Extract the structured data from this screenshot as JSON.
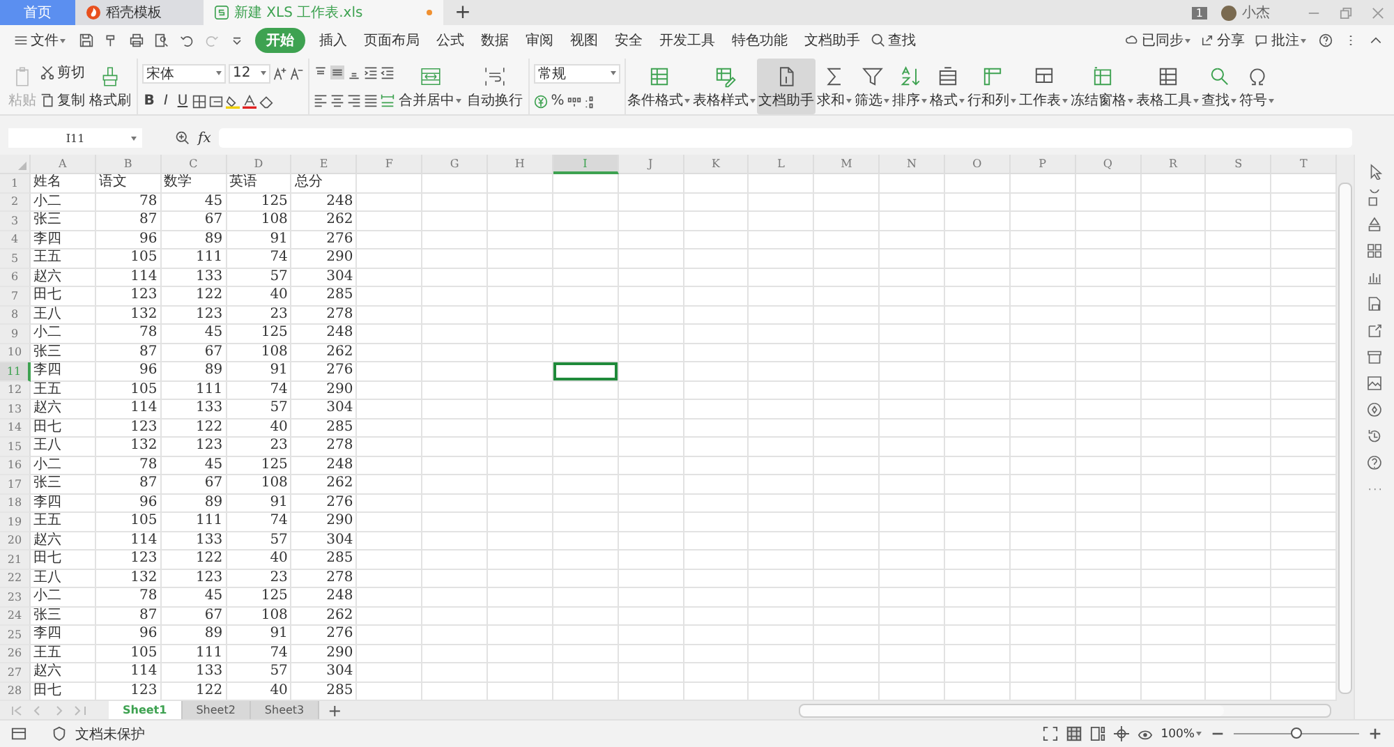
{
  "tabs": [
    {
      "label": "首页",
      "kind": "home",
      "selected": false,
      "unsaved": false
    },
    {
      "label": "稻壳模板",
      "kind": "docer",
      "selected": false,
      "unsaved": false
    },
    {
      "label": "新建 XLS 工作表.xls",
      "kind": "sheet",
      "selected": true,
      "unsaved": true
    }
  ],
  "new_tab": "+",
  "notification_count": "1",
  "user": {
    "name": "小杰"
  },
  "menu": {
    "file": "文件",
    "items": [
      {
        "label": "开始",
        "selected": true
      },
      {
        "label": "插入",
        "selected": false
      },
      {
        "label": "页面布局",
        "selected": false
      },
      {
        "label": "公式",
        "selected": false
      },
      {
        "label": "数据",
        "selected": false
      },
      {
        "label": "审阅",
        "selected": false
      },
      {
        "label": "视图",
        "selected": false
      },
      {
        "label": "安全",
        "selected": false
      },
      {
        "label": "开发工具",
        "selected": false
      },
      {
        "label": "特色功能",
        "selected": false
      },
      {
        "label": "文档助手",
        "selected": false
      }
    ],
    "search": "查找"
  },
  "actions": [
    {
      "label": "已同步",
      "kind": "cloud",
      "dropdown": true
    },
    {
      "label": "分享",
      "kind": "share",
      "dropdown": false
    },
    {
      "label": "批注",
      "kind": "comment",
      "dropdown": true
    }
  ],
  "ribbon": {
    "paste": {
      "label": "粘贴",
      "disabled": true
    },
    "cut": "剪切",
    "copy": "复制",
    "format_painter": "格式刷",
    "font": {
      "family": "宋体",
      "size": "12"
    },
    "font_styles": [
      "B",
      "I",
      "U"
    ],
    "merge": "合并居中",
    "wrap": "自动换行",
    "number_format": "常规",
    "percent": "%",
    "tools": [
      {
        "label": "条件格式",
        "kind": "grid",
        "dropdown": true,
        "pressed": false
      },
      {
        "label": "表格样式",
        "kind": "pen",
        "dropdown": true,
        "pressed": false
      },
      {
        "label": "文档助手",
        "kind": "doc",
        "dropdown": false,
        "pressed": true
      },
      {
        "label": "求和",
        "kind": "sum",
        "dropdown": true,
        "pressed": false
      },
      {
        "label": "筛选",
        "kind": "filter",
        "dropdown": true,
        "pressed": false
      },
      {
        "label": "排序",
        "kind": "sort",
        "dropdown": true,
        "pressed": false
      },
      {
        "label": "格式",
        "kind": "format",
        "dropdown": true,
        "pressed": false
      },
      {
        "label": "行和列",
        "kind": "rowcol",
        "dropdown": true,
        "pressed": false
      },
      {
        "label": "工作表",
        "kind": "sheet",
        "dropdown": true,
        "pressed": false
      },
      {
        "label": "冻结窗格",
        "kind": "freeze",
        "dropdown": true,
        "pressed": false
      },
      {
        "label": "表格工具",
        "kind": "table",
        "dropdown": true,
        "pressed": false
      },
      {
        "label": "查找",
        "kind": "find",
        "dropdown": true,
        "pressed": false
      },
      {
        "label": "符号",
        "kind": "symbol",
        "dropdown": true,
        "pressed": false
      }
    ]
  },
  "formula_bar": {
    "name_box": "I11",
    "fx": "fx"
  },
  "columns": [
    {
      "label": "A",
      "selected": false
    },
    {
      "label": "B",
      "selected": false
    },
    {
      "label": "C",
      "selected": false
    },
    {
      "label": "D",
      "selected": false
    },
    {
      "label": "E",
      "selected": false
    },
    {
      "label": "F",
      "selected": false
    },
    {
      "label": "G",
      "selected": false
    },
    {
      "label": "H",
      "selected": false
    },
    {
      "label": "I",
      "selected": true
    },
    {
      "label": "J",
      "selected": false
    },
    {
      "label": "K",
      "selected": false
    },
    {
      "label": "L",
      "selected": false
    },
    {
      "label": "M",
      "selected": false
    },
    {
      "label": "N",
      "selected": false
    },
    {
      "label": "O",
      "selected": false
    },
    {
      "label": "P",
      "selected": false
    },
    {
      "label": "Q",
      "selected": false
    },
    {
      "label": "R",
      "selected": false
    },
    {
      "label": "S",
      "selected": false
    },
    {
      "label": "T",
      "selected": false
    }
  ],
  "rows": [
    {
      "number": "1",
      "selected": false,
      "kind": "labels",
      "cells": [
        "姓名",
        "语文",
        "数学",
        "英语",
        "总分"
      ]
    },
    {
      "number": "2",
      "selected": false,
      "kind": "values",
      "cells": [
        "小二",
        "78",
        "45",
        "125",
        "248"
      ]
    },
    {
      "number": "3",
      "selected": false,
      "kind": "values",
      "cells": [
        "张三",
        "87",
        "67",
        "108",
        "262"
      ]
    },
    {
      "number": "4",
      "selected": false,
      "kind": "values",
      "cells": [
        "李四",
        "96",
        "89",
        "91",
        "276"
      ]
    },
    {
      "number": "5",
      "selected": false,
      "kind": "values",
      "cells": [
        "王五",
        "105",
        "111",
        "74",
        "290"
      ]
    },
    {
      "number": "6",
      "selected": false,
      "kind": "values",
      "cells": [
        "赵六",
        "114",
        "133",
        "57",
        "304"
      ]
    },
    {
      "number": "7",
      "selected": false,
      "kind": "values",
      "cells": [
        "田七",
        "123",
        "122",
        "40",
        "285"
      ]
    },
    {
      "number": "8",
      "selected": false,
      "kind": "values",
      "cells": [
        "王八",
        "132",
        "123",
        "23",
        "278"
      ]
    },
    {
      "number": "9",
      "selected": false,
      "kind": "values",
      "cells": [
        "小二",
        "78",
        "45",
        "125",
        "248"
      ]
    },
    {
      "number": "10",
      "selected": false,
      "kind": "values",
      "cells": [
        "张三",
        "87",
        "67",
        "108",
        "262"
      ]
    },
    {
      "number": "11",
      "selected": true,
      "kind": "values",
      "cells": [
        "李四",
        "96",
        "89",
        "91",
        "276"
      ]
    },
    {
      "number": "12",
      "selected": false,
      "kind": "values",
      "cells": [
        "王五",
        "105",
        "111",
        "74",
        "290"
      ]
    },
    {
      "number": "13",
      "selected": false,
      "kind": "values",
      "cells": [
        "赵六",
        "114",
        "133",
        "57",
        "304"
      ]
    },
    {
      "number": "14",
      "selected": false,
      "kind": "values",
      "cells": [
        "田七",
        "123",
        "122",
        "40",
        "285"
      ]
    },
    {
      "number": "15",
      "selected": false,
      "kind": "values",
      "cells": [
        "王八",
        "132",
        "123",
        "23",
        "278"
      ]
    },
    {
      "number": "16",
      "selected": false,
      "kind": "values",
      "cells": [
        "小二",
        "78",
        "45",
        "125",
        "248"
      ]
    },
    {
      "number": "17",
      "selected": false,
      "kind": "values",
      "cells": [
        "张三",
        "87",
        "67",
        "108",
        "262"
      ]
    },
    {
      "number": "18",
      "selected": false,
      "kind": "values",
      "cells": [
        "李四",
        "96",
        "89",
        "91",
        "276"
      ]
    },
    {
      "number": "19",
      "selected": false,
      "kind": "values",
      "cells": [
        "王五",
        "105",
        "111",
        "74",
        "290"
      ]
    },
    {
      "number": "20",
      "selected": false,
      "kind": "values",
      "cells": [
        "赵六",
        "114",
        "133",
        "57",
        "304"
      ]
    },
    {
      "number": "21",
      "selected": false,
      "kind": "values",
      "cells": [
        "田七",
        "123",
        "122",
        "40",
        "285"
      ]
    },
    {
      "number": "22",
      "selected": false,
      "kind": "values",
      "cells": [
        "王八",
        "132",
        "123",
        "23",
        "278"
      ]
    },
    {
      "number": "23",
      "selected": false,
      "kind": "values",
      "cells": [
        "小二",
        "78",
        "45",
        "125",
        "248"
      ]
    },
    {
      "number": "24",
      "selected": false,
      "kind": "values",
      "cells": [
        "张三",
        "87",
        "67",
        "108",
        "262"
      ]
    },
    {
      "number": "25",
      "selected": false,
      "kind": "values",
      "cells": [
        "李四",
        "96",
        "89",
        "91",
        "276"
      ]
    },
    {
      "number": "26",
      "selected": false,
      "kind": "values",
      "cells": [
        "王五",
        "105",
        "111",
        "74",
        "290"
      ]
    },
    {
      "number": "27",
      "selected": false,
      "kind": "values",
      "cells": [
        "赵六",
        "114",
        "133",
        "57",
        "304"
      ]
    },
    {
      "number": "28",
      "selected": false,
      "kind": "values",
      "cells": [
        "田七",
        "123",
        "122",
        "40",
        "285"
      ]
    }
  ],
  "sheets": [
    {
      "label": "Sheet1",
      "selected": true
    },
    {
      "label": "Sheet2",
      "selected": false
    },
    {
      "label": "Sheet3",
      "selected": false
    }
  ],
  "add_sheet": "+",
  "status": {
    "protection": "文档未保护",
    "zoom": {
      "reading": "100%",
      "level": 0.5
    }
  }
}
